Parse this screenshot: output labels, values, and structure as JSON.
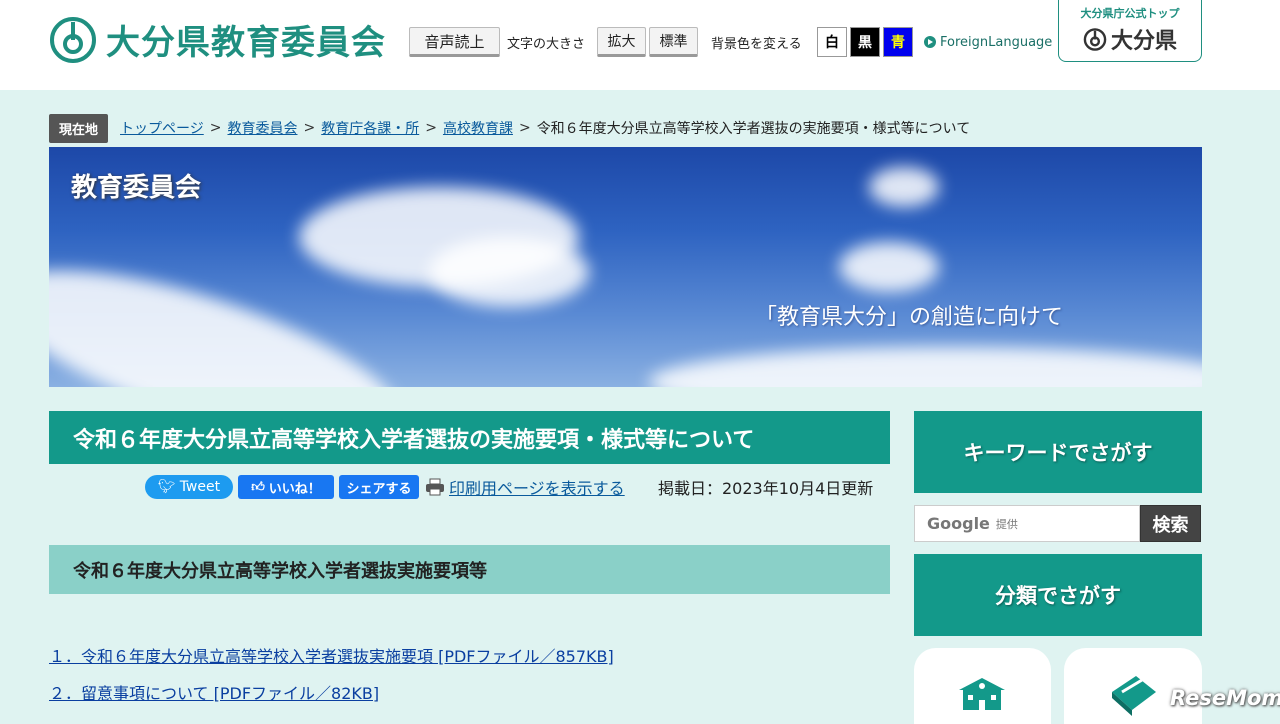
{
  "header": {
    "site_title": "大分県教育委員会",
    "read_aloud": "音声読上",
    "font_size_label": "文字の大きさ",
    "enlarge": "拡大",
    "standard": "標準",
    "bg_color_label": "背景色を変える",
    "bg_white": "白",
    "bg_black": "黒",
    "bg_blue": "青",
    "foreign_language": "ForeignLanguage",
    "pref_top_small": "大分県庁公式トップ",
    "pref_top_big": "大分県"
  },
  "breadcrumb": {
    "label": "現在地",
    "items": [
      "トップページ",
      "教育委員会",
      "教育庁各課・所",
      "高校教育課"
    ],
    "current": "令和６年度大分県立高等学校入学者選抜の実施要項・様式等について"
  },
  "banner": {
    "title": "教育委員会",
    "tagline": "「教育県大分」の創造に向けて"
  },
  "main": {
    "page_title": "令和６年度大分県立高等学校入学者選抜の実施要項・様式等について",
    "tweet": "Tweet",
    "like": "いいね！",
    "share": "シェアする",
    "print": "印刷用ページを表示する",
    "posted": "掲載日：2023年10月4日更新",
    "section_title": "令和６年度大分県立高等学校入学者選抜実施要項等",
    "links": [
      "１．令和６年度大分県立高等学校入学者選抜実施要項 [PDFファイル／857KB]",
      "２．留意事項について [PDFファイル／82KB]"
    ]
  },
  "sidebar": {
    "keyword_head": "キーワードでさがす",
    "google_label": "Google",
    "google_sub": "提供",
    "search_button": "検索",
    "category_head": "分類でさがす"
  },
  "watermark": "ReseMom",
  "colors": {
    "brand_green": "#13998a",
    "section_green": "#8ad0c8",
    "page_bg": "#dff3f1"
  }
}
